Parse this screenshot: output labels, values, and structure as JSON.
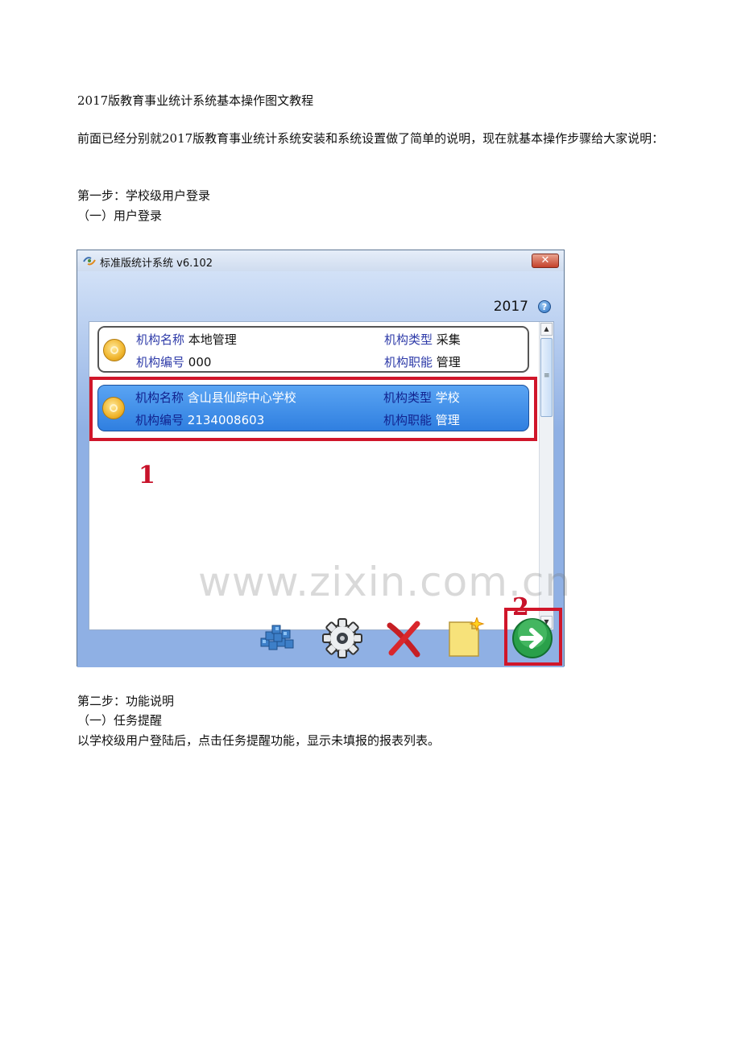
{
  "document": {
    "title": "2017版教育事业统计系统基本操作图文教程",
    "intro": "前面已经分别就2017版教育事业统计系统安装和系统设置做了简单的说明，现在就基本操作步骤给大家说明：",
    "step1": "第一步：学校级用户登录",
    "step1_sub": "（一）用户登录",
    "step2": "第二步：功能说明",
    "step2_sub": "（一）任务提醒",
    "step2_desc": "以学校级用户登陆后，点击任务提醒功能，显示未填报的报表列表。"
  },
  "app": {
    "window_title": "标准版统计系统 v6.102",
    "close_label": "✕",
    "year": "2017",
    "help_label": "?",
    "orgs": [
      {
        "name_label": "机构名称",
        "name": "本地管理",
        "code_label": "机构编号",
        "code": "000",
        "type_label": "机构类型",
        "type": "采集",
        "func_label": "机构职能",
        "func": "管理"
      },
      {
        "name_label": "机构名称",
        "name": "含山县仙踪中心学校",
        "code_label": "机构编号",
        "code": "2134008603",
        "type_label": "机构类型",
        "type": "学校",
        "func_label": "机构职能",
        "func": "管理"
      }
    ],
    "scroll_up": "▲",
    "scroll_down": "▼",
    "annotation_1": "1",
    "annotation_2": "2",
    "watermark": "www.zixin.com.cn",
    "toolbar_icons": [
      "database-icon",
      "settings-gear-icon",
      "delete-x-icon",
      "new-document-icon",
      "login-arrow-icon"
    ],
    "colors": {
      "selected_row": "#3a8ae8",
      "highlight": "#d0162a",
      "login_button": "#2aa04a"
    }
  }
}
